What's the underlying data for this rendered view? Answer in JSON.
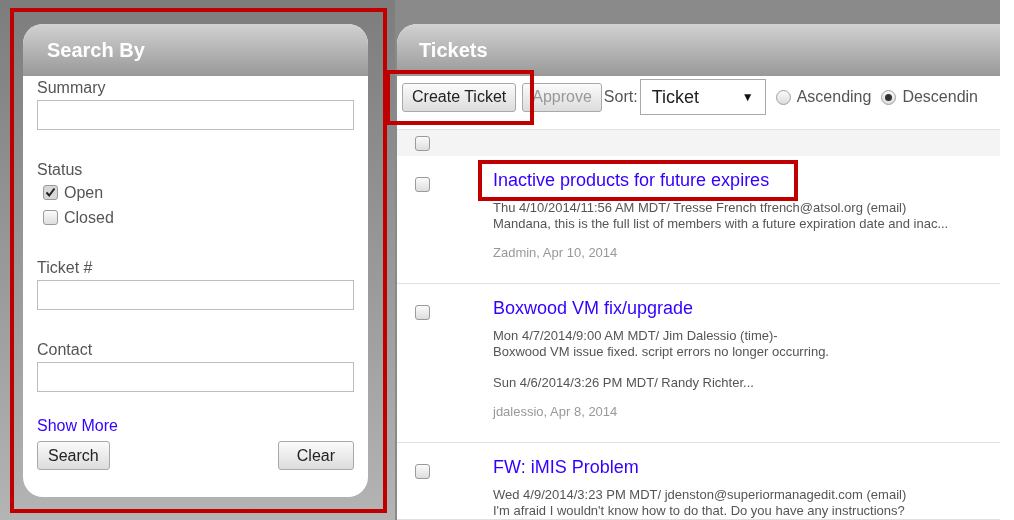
{
  "search_panel": {
    "title": "Search By",
    "items": [
      {
        "kind": "text_field",
        "label": "Summary"
      },
      {
        "kind": "checkbox_group",
        "label": "Status",
        "options": [
          {
            "label": "Open",
            "checked": true
          },
          {
            "label": "Closed",
            "checked": false
          }
        ]
      },
      {
        "kind": "text_field",
        "label": "Ticket #"
      },
      {
        "kind": "text_field",
        "label": "Contact"
      }
    ],
    "show_more": "Show More",
    "search_button": "Search",
    "clear_button": "Clear"
  },
  "tickets_panel": {
    "title": "Tickets",
    "toolbar": {
      "create_button": {
        "label": "Create Ticket",
        "disabled": false
      },
      "approve_button": {
        "label": "Approve",
        "disabled": true
      },
      "sort_label": "Sort:",
      "sort_value": "Ticket",
      "sort_caret": "▼",
      "order": [
        {
          "label": "Ascending",
          "selected": false
        },
        {
          "label": "Descendin",
          "selected": true
        }
      ]
    },
    "select_all": {
      "checked": false
    },
    "rows": [
      {
        "title": "Inactive products for future expires",
        "checked": false,
        "paragraphs": [
          [
            "Thu 4/10/2014/11:56 AM MDT/ Tresse French tfrench@atsol.org (email)",
            "Mandana, this is the full list of members with a future expiration date and inac..."
          ]
        ],
        "footer": "Zadmin, Apr 10, 2014"
      },
      {
        "title": "Boxwood VM fix/upgrade",
        "checked": false,
        "paragraphs": [
          [
            "Mon 4/7/2014/9:00 AM MDT/ Jim Dalessio (time)-",
            "Boxwood VM issue fixed. script errors no longer occurring."
          ],
          [
            "Sun 4/6/2014/3:26 PM MDT/ Randy Richter..."
          ]
        ],
        "footer": "jdalessio, Apr 8, 2014"
      },
      {
        "title": "FW: iMIS Problem",
        "checked": false,
        "paragraphs": [
          [
            "Wed 4/9/2014/3:23 PM MDT/ jdenston@superiormanagedit.com (email)",
            "I'm afraid I wouldn't know how to do that. Do you have any instructions?"
          ]
        ]
      }
    ]
  }
}
